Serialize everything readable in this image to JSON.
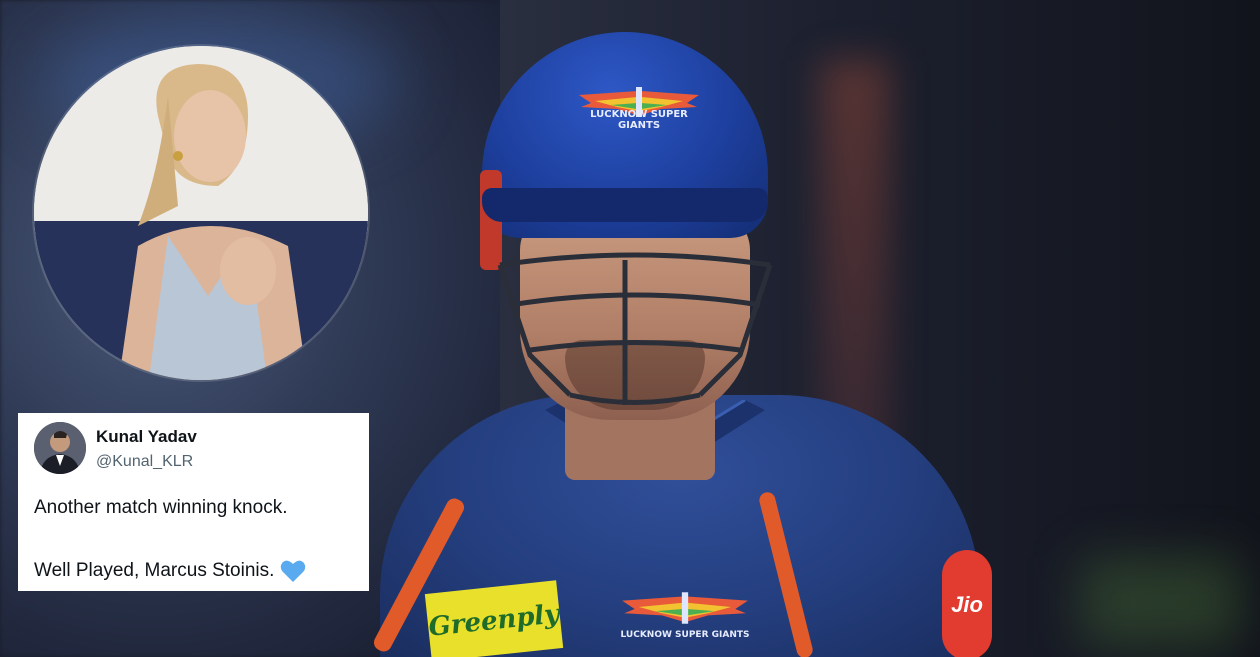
{
  "photo": {
    "helmet_logo": "LUCKNOW SUPER GIANTS",
    "chest_logo": "LUCKNOW SUPER GIANTS",
    "sponsor_text": "Greenply",
    "jersey_badge_text": "Jio",
    "colors": {
      "helmet_blue": "#1d3f9e",
      "jersey_blue": "#243e7e",
      "accent_orange": "#e05a2a",
      "sponsor_yellow": "#e8e02a"
    }
  },
  "inset": {
    "description_icon": "spectator-photo"
  },
  "tweet": {
    "name": "Kunal Yadav",
    "handle": "@Kunal_KLR",
    "line1": "Another match winning knock.",
    "line2": "Well Played, Marcus Stoinis.",
    "emoji_icon": "blue-heart-icon",
    "emoji_color": "#5aaaf0"
  }
}
